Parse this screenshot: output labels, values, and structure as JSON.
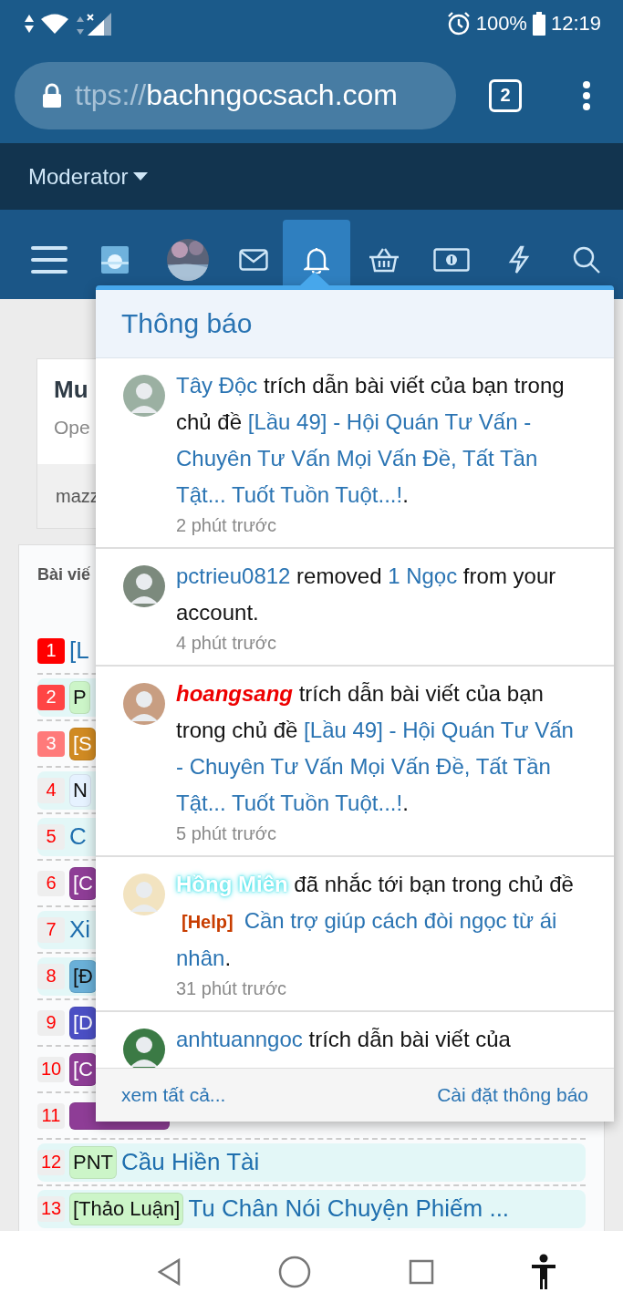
{
  "status_bar": {
    "battery": "100%",
    "time": "12:19"
  },
  "browser": {
    "url_scheme": "ttps://",
    "url_host": "bachngocsach.com",
    "tab_count": "2"
  },
  "moderator_menu": {
    "label": "Moderator"
  },
  "nav": [
    {
      "kind": "menu",
      "selected": false
    },
    {
      "kind": "logo",
      "selected": false
    },
    {
      "kind": "avatar",
      "selected": false
    },
    {
      "kind": "mail",
      "selected": false
    },
    {
      "kind": "bell",
      "selected": true
    },
    {
      "kind": "basket",
      "selected": false
    },
    {
      "kind": "money",
      "selected": false
    },
    {
      "kind": "bolt",
      "selected": false
    },
    {
      "kind": "search",
      "selected": false
    }
  ],
  "page": {
    "card": {
      "title": "Mu",
      "subtitle": "Ope",
      "footer": "mazz"
    },
    "panel": {
      "title": "Bài viế",
      "rows": [
        {
          "rank": "1",
          "highlighted": false,
          "title": "[L"
        },
        {
          "rank": "2",
          "highlighted": true,
          "tag": {
            "text": "P",
            "color": "#ccf5c8"
          }
        },
        {
          "rank": "3",
          "highlighted": false,
          "tag": {
            "text": "[S",
            "color": "#d08a22"
          }
        },
        {
          "rank": "4",
          "highlighted": true,
          "tag": {
            "text": "N",
            "color": "#e6f2ff"
          }
        },
        {
          "rank": "5",
          "highlighted": true,
          "title": "C"
        },
        {
          "rank": "6",
          "highlighted": false,
          "tag": {
            "text": "[C",
            "color": "#8e3d96"
          }
        },
        {
          "rank": "7",
          "highlighted": true,
          "title": "Xi"
        },
        {
          "rank": "8",
          "highlighted": true,
          "tag": {
            "text": "[Đ",
            "color": "#6ab0d8"
          }
        },
        {
          "rank": "9",
          "highlighted": false,
          "tag": {
            "text": "[D",
            "color": "#4b4fc4"
          }
        },
        {
          "rank": "10",
          "highlighted": false,
          "tag": {
            "text": "[C",
            "color": "#8e3d96"
          }
        },
        {
          "rank": "11",
          "highlighted": false,
          "tag": {
            "color": "#8e3d96"
          }
        },
        {
          "rank": "12",
          "highlighted": true,
          "tag": {
            "text": "PNT",
            "color": "#ccf5c8"
          },
          "title": "Cầu Hiền Tài"
        },
        {
          "rank": "13",
          "highlighted": true,
          "tag": {
            "text": "[Thảo Luận]",
            "color": "#ccf5c8"
          },
          "title": "Tu Chân Nói Chuyện Phiếm ..."
        }
      ]
    }
  },
  "notifications": {
    "title": "Thông báo",
    "items": [
      {
        "segments": [
          {
            "kind": "user",
            "text": "Tây Độc"
          },
          {
            "kind": "text",
            "text": " trích dẫn bài viết của bạn trong chủ đề "
          },
          {
            "kind": "link",
            "text": "[Lầu 49] - Hội Quán Tư Vấn - Chuyên Tư Vấn Mọi Vấn Đề, Tất Tần Tật... Tuốt Tuồn Tuột...!"
          },
          {
            "kind": "text",
            "text": "."
          }
        ],
        "time": "2 phút trước"
      },
      {
        "segments": [
          {
            "kind": "user",
            "text": "pctrieu0812"
          },
          {
            "kind": "text",
            "text": " removed "
          },
          {
            "kind": "link",
            "text": "1 Ngọc"
          },
          {
            "kind": "text",
            "text": " from your account."
          }
        ],
        "time": "4 phút trước"
      },
      {
        "segments": [
          {
            "kind": "redname",
            "text": "hoangsang"
          },
          {
            "kind": "text",
            "text": " trích dẫn bài viết của bạn trong chủ đề "
          },
          {
            "kind": "link",
            "text": "[Lầu 49] - Hội Quán Tư Vấn - Chuyên Tư Vấn Mọi Vấn Đề, Tất Tần Tật... Tuốt Tuồn Tuột...!"
          },
          {
            "kind": "text",
            "text": "."
          }
        ],
        "time": "5 phút trước"
      },
      {
        "segments": [
          {
            "kind": "glowname",
            "text": "Hồng Miên"
          },
          {
            "kind": "text",
            "text": " đã nhắc tới bạn trong chủ đề "
          },
          {
            "kind": "prefix",
            "text": "[Help]"
          },
          {
            "kind": "link",
            "text": "Cần trợ giúp cách đòi ngọc từ ái nhân"
          },
          {
            "kind": "text",
            "text": "."
          }
        ],
        "time": "31 phút trước"
      },
      {
        "segments": [
          {
            "kind": "user",
            "text": "anhtuanngoc"
          },
          {
            "kind": "text",
            "text": " trích dẫn bài viết của"
          }
        ]
      }
    ],
    "footer_left": "xem tất cả...",
    "footer_right": "Cài đặt thông báo"
  }
}
